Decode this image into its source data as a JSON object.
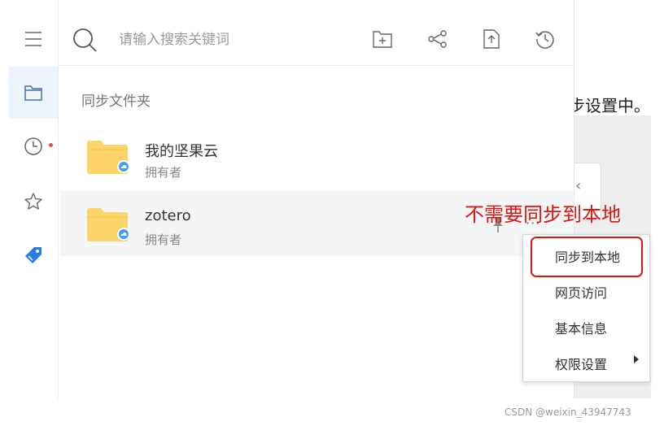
{
  "background": {
    "doc_text": "步设置中。"
  },
  "rail": {
    "items": [
      {
        "name": "menu",
        "icon": "hamburger-menu-icon"
      },
      {
        "name": "files",
        "icon": "folder-icon",
        "active": true
      },
      {
        "name": "recent",
        "icon": "clock-icon",
        "has_dot": true
      },
      {
        "name": "favorites",
        "icon": "star-icon"
      },
      {
        "name": "tags",
        "icon": "tag-icon"
      }
    ]
  },
  "search": {
    "placeholder": "请输入搜索关键词"
  },
  "toolbar": {
    "buttons": [
      {
        "name": "new-folder",
        "icon": "new-folder-icon"
      },
      {
        "name": "share",
        "icon": "share-icon"
      },
      {
        "name": "upload",
        "icon": "upload-file-icon"
      },
      {
        "name": "history",
        "icon": "history-icon"
      }
    ]
  },
  "section": {
    "title": "同步文件夹"
  },
  "folders": [
    {
      "name": "我的坚果云",
      "role": "拥有者"
    },
    {
      "name": "zotero",
      "role": "拥有者",
      "more": "···"
    }
  ],
  "annotation": {
    "text": "不需要同步到本地",
    "color": "#e0140f"
  },
  "context_menu": {
    "items": [
      {
        "label": "同步到本地",
        "highlighted": true
      },
      {
        "label": "网页访问"
      },
      {
        "label": "基本信息"
      },
      {
        "label": "权限设置",
        "has_submenu": true
      }
    ]
  },
  "watermark": {
    "text": "CSDN @weixin_43947743"
  },
  "colors": {
    "folder": "#fcd46a",
    "cloud_badge": "#3d9df2",
    "accent": "#2a7de1",
    "annotation": "#e0140f"
  }
}
